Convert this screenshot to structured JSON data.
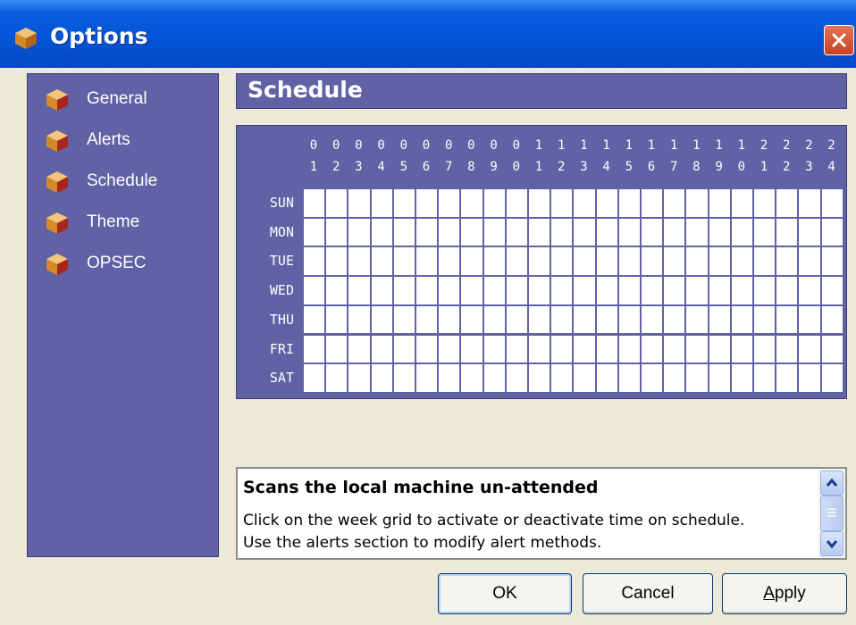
{
  "window": {
    "title": "Options"
  },
  "sidebar": {
    "items": [
      {
        "label": "General",
        "icon": "box-icon"
      },
      {
        "label": "Alerts",
        "icon": "box-icon"
      },
      {
        "label": "Schedule",
        "icon": "box-icon"
      },
      {
        "label": "Theme",
        "icon": "box-icon"
      },
      {
        "label": "OPSEC",
        "icon": "box-icon"
      }
    ]
  },
  "section": {
    "title": "Schedule"
  },
  "schedule": {
    "hours_top": [
      "0",
      "0",
      "0",
      "0",
      "0",
      "0",
      "0",
      "0",
      "0",
      "0",
      "1",
      "1",
      "1",
      "1",
      "1",
      "1",
      "1",
      "1",
      "1",
      "1",
      "2",
      "2",
      "2",
      "2"
    ],
    "hours_bottom": [
      "1",
      "2",
      "3",
      "4",
      "5",
      "6",
      "7",
      "8",
      "9",
      "0",
      "1",
      "2",
      "3",
      "4",
      "5",
      "6",
      "7",
      "8",
      "9",
      "0",
      "1",
      "2",
      "3",
      "4"
    ],
    "days": [
      "SUN",
      "MON",
      "TUE",
      "WED",
      "THU",
      "FRI",
      "SAT"
    ]
  },
  "info": {
    "title": "Scans the local machine un-attended",
    "line1": "Click on the week grid to activate or deactivate time on schedule.",
    "line2": "Use the alerts section to modify alert methods."
  },
  "buttons": {
    "ok": "OK",
    "cancel": "Cancel",
    "apply_accel": "A",
    "apply_rest": "pply"
  },
  "colors": {
    "panel": "#6161a6",
    "titlebar": "#0553d6",
    "close": "#d1512e"
  }
}
